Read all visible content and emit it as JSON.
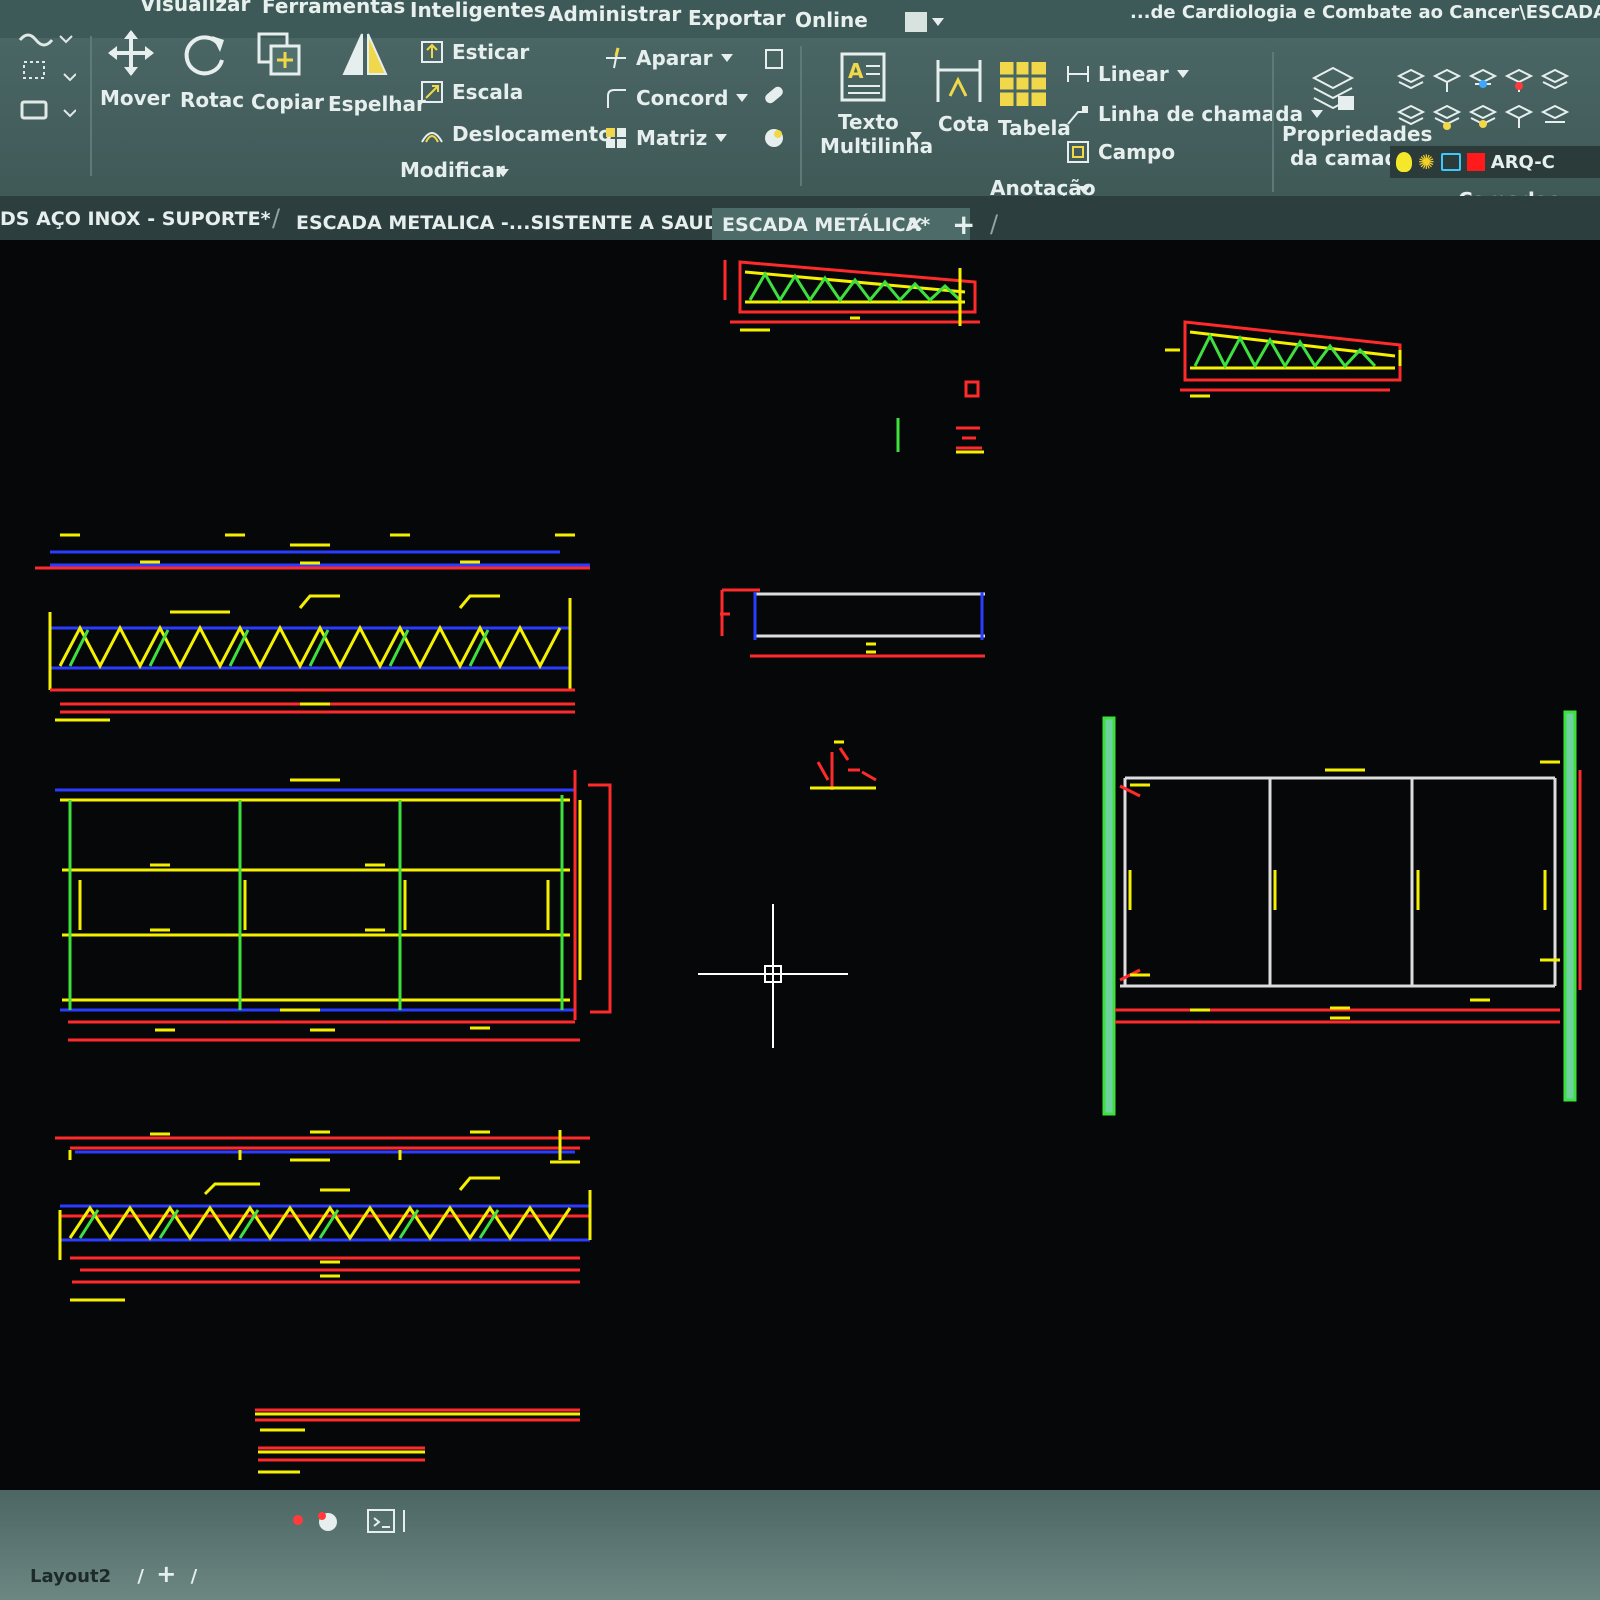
{
  "ribbon_tabs": [
    "Visualizar",
    "Ferramentas",
    "Inteligentes",
    "Administrar",
    "Exportar",
    "Online"
  ],
  "title_path": "...de Cardiologia e Combate ao Cancer\\ESCADA ME",
  "modify": {
    "move": "Mover",
    "rotate": "Rotac",
    "copy": "Copiar",
    "mirror": "Espelhar",
    "stretch": "Esticar",
    "scale": "Escala",
    "offset": "Deslocamento",
    "trim": "Aparar",
    "fillet": "Concord",
    "array": "Matriz",
    "title": "Modificar"
  },
  "annotation": {
    "mtext_line1": "Texto",
    "mtext_line2": "Multilinha",
    "dimension": "Cota",
    "table": "Tabela",
    "linear": "Linear",
    "leader": "Linha de chamada",
    "field": "Campo",
    "title": "Anotação"
  },
  "layers": {
    "properties_line1": "Propriedades",
    "properties_line2": "da camada",
    "current_layer": "ARQ-C",
    "title": "Camadas"
  },
  "doc_tabs": {
    "tab1": "DS AÇO INOX - SUPORTE*",
    "tab2": "ESCADA METALICA -...SISTENTE A SAUDE*",
    "tab3": "ESCADA METÁLICA*"
  },
  "layout_tab": "Layout2",
  "colors": {
    "ribbon": "#4a6664",
    "accent_red": "#ff2a2a",
    "accent_yellow": "#f5f000",
    "accent_blue": "#2a3cff",
    "accent_green": "#3ee03e"
  }
}
